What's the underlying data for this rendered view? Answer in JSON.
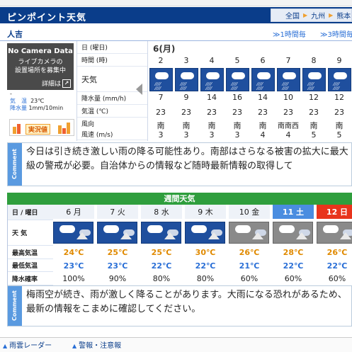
{
  "header": {
    "title": "ピンポイント天気",
    "breadcrumb": [
      "全国",
      "九州",
      "熊本"
    ]
  },
  "location": {
    "name": "人吉",
    "link_1h": "1時間毎",
    "link_3h": "3時間毎"
  },
  "camera": {
    "title": "No Camera Data",
    "line1": "ライブカメラの",
    "line2": "設置場所を募集中",
    "detail": "詳細は"
  },
  "observation": {
    "dash": "-",
    "temp_label": "気　温",
    "temp_value": "23℃",
    "rain_label": "降水量",
    "rain_value": "1mm/10min",
    "actual_label": "実況値"
  },
  "hourly": {
    "labels": {
      "day": "日 (曜日)",
      "hour": "時間 (時)",
      "weather": "天気",
      "precip": "降水量 (mm/h)",
      "temp": "気温 (℃)",
      "wind_dir": "風向",
      "wind_speed": "風速 (m/s)"
    },
    "date": "6(月)",
    "hours": [
      "2",
      "3",
      "4",
      "5",
      "6",
      "7",
      "8",
      "9"
    ],
    "precip": [
      "7",
      "9",
      "14",
      "16",
      "14",
      "10",
      "12",
      "12"
    ],
    "temp": [
      "23",
      "23",
      "23",
      "23",
      "23",
      "23",
      "23",
      "23"
    ],
    "wind_dir": [
      "南",
      "南",
      "南",
      "南",
      "南",
      "南南西",
      "南",
      "南"
    ],
    "wind_speed": [
      "3",
      "3",
      "3",
      "3",
      "4",
      "4",
      "5",
      "5"
    ],
    "icons": [
      "heavy-rain-icon",
      "heavy-rain-icon",
      "heavy-rain-icon",
      "heavy-rain-icon",
      "heavy-rain-icon",
      "heavy-rain-icon",
      "heavy-rain-icon",
      "heavy-rain-icon"
    ]
  },
  "comment_top": {
    "tag": "Comment",
    "text": "今日は引き続き激しい雨の降る可能性あり。南部はさらなる被害の拡大に最大級の警戒が必要。自治体からの情報など随時最新情報の取得して"
  },
  "weekly": {
    "title": "週間天気",
    "labels": {
      "day": "日 / 曜日",
      "weather": "天 気",
      "high": "最高気温",
      "low": "最低気温",
      "rain": "降水確率"
    },
    "days": [
      {
        "day": "6 月",
        "high": "24℃",
        "low": "23℃",
        "rain": "100%"
      },
      {
        "day": "7 火",
        "high": "25℃",
        "low": "23℃",
        "rain": "90%"
      },
      {
        "day": "8 水",
        "high": "25℃",
        "low": "22℃",
        "rain": "80%"
      },
      {
        "day": "9 木",
        "high": "30℃",
        "low": "22℃",
        "rain": "80%"
      },
      {
        "day": "10 金",
        "high": "26℃",
        "low": "21℃",
        "rain": "60%"
      },
      {
        "day": "11 土",
        "high": "28℃",
        "low": "22℃",
        "rain": "60%"
      },
      {
        "day": "12 日",
        "high": "26℃",
        "low": "22℃",
        "rain": "60%"
      }
    ],
    "colors": {
      "high": "#e08a00",
      "low": "#2a6fd6",
      "sat": "#2a6fd6",
      "sun": "#e8341c"
    }
  },
  "comment_bottom": {
    "tag": "Comment",
    "text": "梅雨空が続き、雨が激しく降ることがあります。大雨になる恐れがあるため、最新の情報をこまめに確認してください。"
  },
  "footer": {
    "link1": "雨雲レーダー",
    "link2": "警報・注意報"
  }
}
